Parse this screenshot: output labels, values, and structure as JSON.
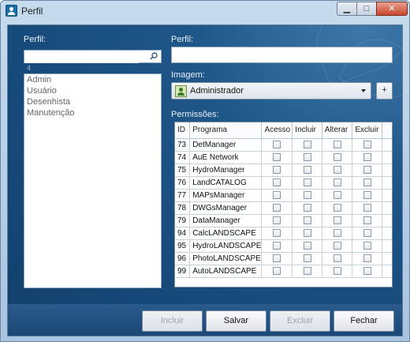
{
  "window": {
    "title": "Perfil",
    "minimize": "▁",
    "maximize": "□",
    "close": "✕"
  },
  "left": {
    "label": "Perfil:",
    "search": {
      "value": "",
      "placeholder": ""
    },
    "count": "4",
    "items": [
      {
        "label": "Admin"
      },
      {
        "label": "Usuário"
      },
      {
        "label": "Desenhista"
      },
      {
        "label": "Manutenção"
      }
    ]
  },
  "right": {
    "perfil_label": "Perfil:",
    "perfil_value": "",
    "imagem_label": "Imagem:",
    "imagem_value": "Administrador",
    "plus_label": "+",
    "permissoes_label": "Permissões:",
    "columns": [
      "ID",
      "Programa",
      "Acesso",
      "Incluir",
      "Alterar",
      "Excluir"
    ],
    "rows": [
      {
        "id": "73",
        "programa": "DetManager"
      },
      {
        "id": "74",
        "programa": "AuE Network"
      },
      {
        "id": "75",
        "programa": "HydroManager"
      },
      {
        "id": "76",
        "programa": "LandCATALOG"
      },
      {
        "id": "77",
        "programa": "MAPsManager"
      },
      {
        "id": "78",
        "programa": "DWGsManager"
      },
      {
        "id": "79",
        "programa": "DataManager"
      },
      {
        "id": "94",
        "programa": "CalcLANDSCAPE"
      },
      {
        "id": "95",
        "programa": "HydroLANDSCAPE"
      },
      {
        "id": "96",
        "programa": "PhotoLANDSCAPE"
      },
      {
        "id": "99",
        "programa": "AutoLANDSCAPE"
      }
    ]
  },
  "buttons": {
    "incluir": "Incluir",
    "salvar": "Salvar",
    "excluir": "Excluir",
    "fechar": "Fechar"
  },
  "icons": {
    "app": "user-profile-icon",
    "search": "search-icon",
    "image": "user-image-icon",
    "dropdown": "chevron-down-icon"
  },
  "colors": {
    "client_background": "#164a7a",
    "titlebar": "#c7dbee",
    "close_button": "#c8472d"
  }
}
